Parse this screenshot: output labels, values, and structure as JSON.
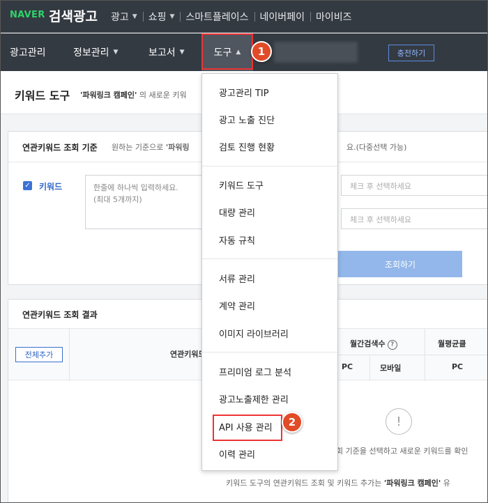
{
  "topbar": {
    "logo_brand": "NAVER",
    "logo_title": "검색광고",
    "menu": [
      {
        "label": "광고",
        "has_chevron": true
      },
      {
        "label": "쇼핑",
        "has_chevron": true
      },
      {
        "label": "스마트플레이스",
        "has_chevron": false
      },
      {
        "label": "네이버페이",
        "has_chevron": false
      },
      {
        "label": "마이비즈",
        "has_chevron": false
      }
    ]
  },
  "nav": {
    "ad_manage": "광고관리",
    "info_manage": "정보관리",
    "report": "보고서",
    "tools": "도구",
    "charge_button": "충전하기",
    "chevron_down": "⌄",
    "chevron_up": "^"
  },
  "callouts": {
    "first": "1",
    "second": "2"
  },
  "page_header": {
    "title": "키워드 도구",
    "subtitle_campaign": "'파워링크 캠페인'",
    "subtitle_rest": "의 새로운 키워"
  },
  "criteria": {
    "title": "연관키워드 조회 기준",
    "desc_prefix": "원하는 기준으로",
    "desc_bold": "'파워링",
    "note": "요.(다중선택 가능)",
    "keyword_label": "키워드",
    "keyword_checked": true,
    "keyword_placeholder": "한줄에 하나씩 입력하세요.\n(최대 5개까지)",
    "select1_placeholder": "체크 후 선택하세요",
    "select2_placeholder": "체크 후 선택하세요",
    "search_button": "조회하기"
  },
  "results": {
    "title": "연관키워드 조회 결과",
    "add_all_button": "전체추가",
    "col_keyword": "연관키워드",
    "col_monthly": "월간검색수",
    "col_avg": "월평균클",
    "col_pc": "PC",
    "col_mobile": "모바일",
    "col_pc2": "PC",
    "empty_icon": "!",
    "empty_text": "회 기준을 선택하고 새로운 키워드를 확인",
    "footer_prefix": "키워드 도구의 연관키워드 조회 및 키워드 추가는",
    "footer_bold": "'파워링크 캠페인'",
    "footer_suffix": "유"
  },
  "dropdown": {
    "groups": [
      [
        "광고관리 TIP",
        "광고 노출 진단",
        "검토 진행 현황"
      ],
      [
        "키워드 도구",
        "대량 관리",
        "자동 규칙"
      ],
      [
        "서류 관리",
        "계약 관리",
        "이미지 라이브러리"
      ],
      [
        "프리미엄 로그 분석",
        "광고노출제한 관리",
        "API 사용 관리",
        "이력 관리"
      ]
    ]
  }
}
